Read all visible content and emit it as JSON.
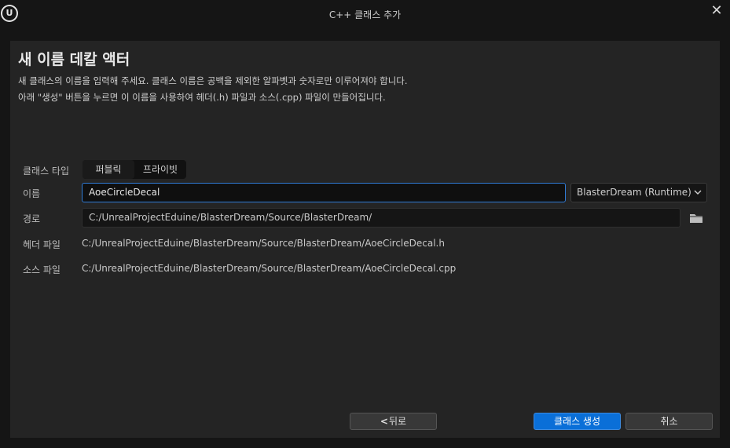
{
  "window": {
    "title": "C++ 클래스 추가",
    "logo_icon": "unreal-engine-logo",
    "close_glyph": "✕"
  },
  "header": {
    "title": "새 이름 데칼 액터",
    "description_line1": "새 클래스의 이름을 입력해 주세요. 클래스 이름은 공백을 제외한 알파벳과 숫자로만 이루어져야 합니다.",
    "description_line2": "아래 \"생성\" 버튼을 누르면 이 이름을 사용하여 헤더(.h) 파일과 소스(.cpp) 파일이 만들어집니다."
  },
  "form": {
    "class_type": {
      "label": "클래스 타입",
      "options": [
        "퍼블릭",
        "프라이빗"
      ]
    },
    "name": {
      "label": "이름",
      "value": "AoeCircleDecal"
    },
    "module": {
      "value": "BlasterDream (Runtime)"
    },
    "path": {
      "label": "경로",
      "value": "C:/UnrealProjectEduine/BlasterDream/Source/BlasterDream/"
    },
    "header_file": {
      "label": "헤더 파일",
      "value": "C:/UnrealProjectEduine/BlasterDream/Source/BlasterDream/AoeCircleDecal.h"
    },
    "source_file": {
      "label": "소스 파일",
      "value": "C:/UnrealProjectEduine/BlasterDream/Source/BlasterDream/AoeCircleDecal.cpp"
    }
  },
  "buttons": {
    "back_label": "뒤로",
    "back_glyph": "<",
    "create_label": "클래스 생성",
    "cancel_label": "취소"
  },
  "colors": {
    "accent": "#0a6fd8",
    "background": "#151515",
    "panel": "#242424"
  }
}
